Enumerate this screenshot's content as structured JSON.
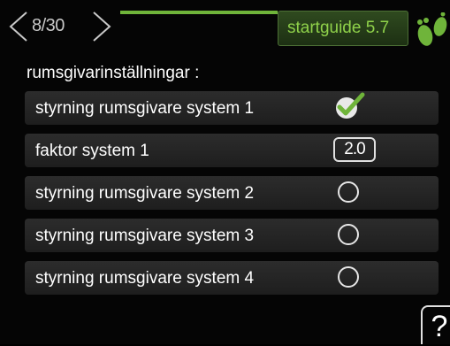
{
  "header": {
    "page_indicator": "8/30",
    "guide_title": "startguide 5.7",
    "accent_color": "#6fb43a"
  },
  "section_label": "rumsgivarinställningar :",
  "rows": [
    {
      "label": "styrning rumsgivare system 1",
      "control": "checkbox",
      "checked": true
    },
    {
      "label": "faktor system 1",
      "control": "value",
      "value": "2.0"
    },
    {
      "label": "styrning rumsgivare system 2",
      "control": "checkbox",
      "checked": false
    },
    {
      "label": "styrning rumsgivare system 3",
      "control": "checkbox",
      "checked": false
    },
    {
      "label": "styrning rumsgivare system 4",
      "control": "checkbox",
      "checked": false
    }
  ],
  "icons": {
    "prev": "chevron-left-icon",
    "next": "chevron-right-icon",
    "logo": "footprints-icon",
    "help": "help-icon"
  },
  "help_label": "?"
}
